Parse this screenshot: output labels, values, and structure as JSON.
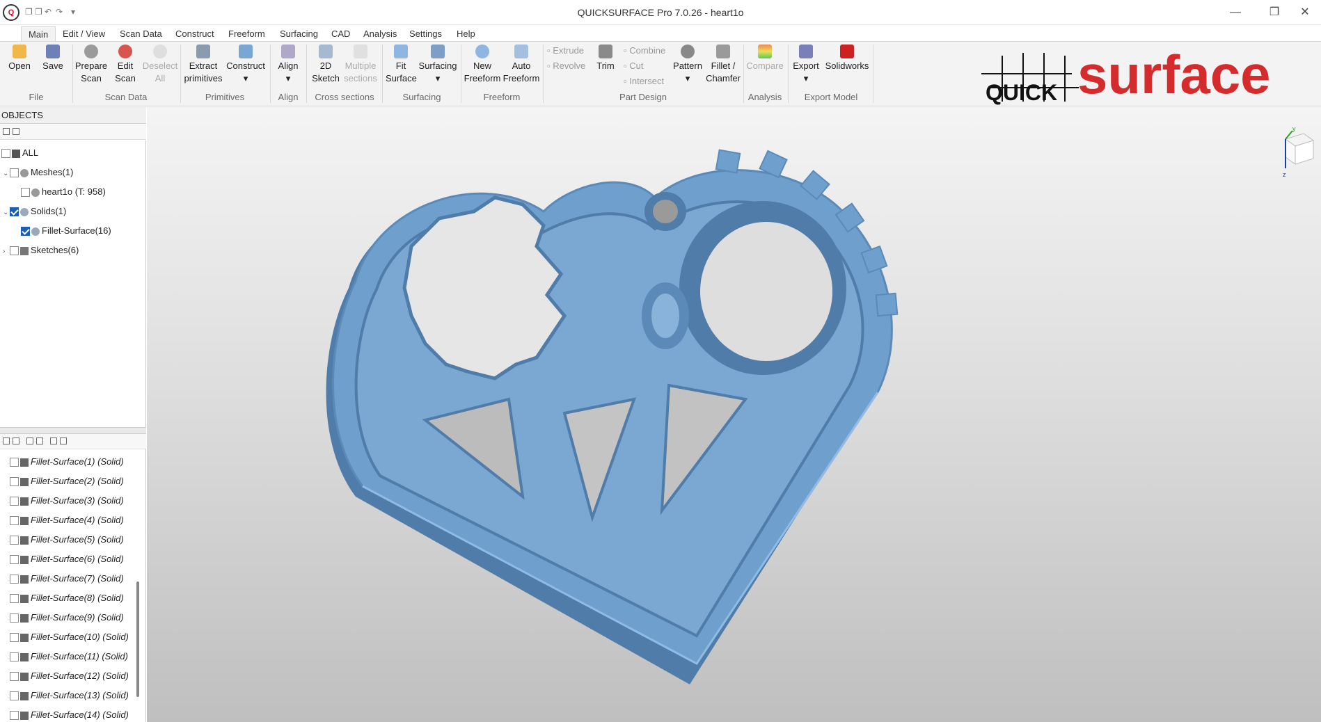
{
  "window": {
    "title": "QUICKSURFACE Pro 7.0.26 - heart1o",
    "logo_text": "Q",
    "quick_access": [
      "❐",
      "❐",
      "↶",
      "↷",
      "▾"
    ],
    "minimize": "—",
    "maximize": "❐",
    "close": "✕"
  },
  "menu": {
    "tabs": [
      "Main",
      "Edit / View",
      "Scan Data",
      "Construct",
      "Freeform",
      "Surfacing",
      "CAD",
      "Analysis",
      "Settings",
      "Help"
    ],
    "active": "Main"
  },
  "ribbon": {
    "open": "Open",
    "save": "Save",
    "prepare_scan": [
      "Prepare",
      "Scan"
    ],
    "edit_scan": [
      "Edit",
      "Scan"
    ],
    "deselect_all": [
      "Deselect",
      "All"
    ],
    "extract_primitives": [
      "Extract",
      "primitives"
    ],
    "construct": "Construct",
    "align": "Align",
    "sketch_2d": [
      "2D",
      "Sketch"
    ],
    "multiple_sections": [
      "Multiple",
      "sections"
    ],
    "fit_surface": [
      "Fit",
      "Surface"
    ],
    "surfacing": "Surfacing",
    "new_freeform": [
      "New",
      "Freeform"
    ],
    "auto_freeform": [
      "Auto",
      "Freeform"
    ],
    "extrude": "Extrude",
    "revolve": "Revolve",
    "trim": "Trim",
    "combine": "Combine",
    "cut": "Cut",
    "intersect": "Intersect",
    "pattern": "Pattern",
    "fillet_chamfer": [
      "Fillet /",
      "Chamfer"
    ],
    "compare": "Compare",
    "export": "Export",
    "solidworks": "Solidworks",
    "groups": {
      "file": "File",
      "scan_data": "Scan Data",
      "primitives": "Primitives",
      "align": "Align",
      "cross_sections": "Cross sections",
      "surfacing": "Surfacing",
      "freeform": "Freeform",
      "part_design": "Part Design",
      "analysis": "Analysis",
      "export_model": "Export Model"
    }
  },
  "brand": {
    "quick": "QUICK",
    "surface": "surface"
  },
  "objects": {
    "header": "OBJECTS",
    "tree": {
      "all": "ALL",
      "meshes": "Meshes(1)",
      "mesh_item": "heart1o (T: 958)",
      "solids": "Solids(1)",
      "solid_item": "Fillet-Surface(16)",
      "sketches": "Sketches(6)"
    }
  },
  "list_items": [
    "Fillet-Surface(1) (Solid)",
    "Fillet-Surface(2) (Solid)",
    "Fillet-Surface(3) (Solid)",
    "Fillet-Surface(4) (Solid)",
    "Fillet-Surface(5) (Solid)",
    "Fillet-Surface(6) (Solid)",
    "Fillet-Surface(7) (Solid)",
    "Fillet-Surface(8) (Solid)",
    "Fillet-Surface(9) (Solid)",
    "Fillet-Surface(10) (Solid)",
    "Fillet-Surface(11) (Solid)",
    "Fillet-Surface(12) (Solid)",
    "Fillet-Surface(13) (Solid)",
    "Fillet-Surface(14) (Solid)"
  ],
  "viewport": {
    "model_color": "#6f9fcc",
    "axis_labels": {
      "y": "y",
      "z": "z"
    }
  },
  "colors": {
    "accent": "#1a5fb4",
    "brand_red": "#d42c2c"
  }
}
